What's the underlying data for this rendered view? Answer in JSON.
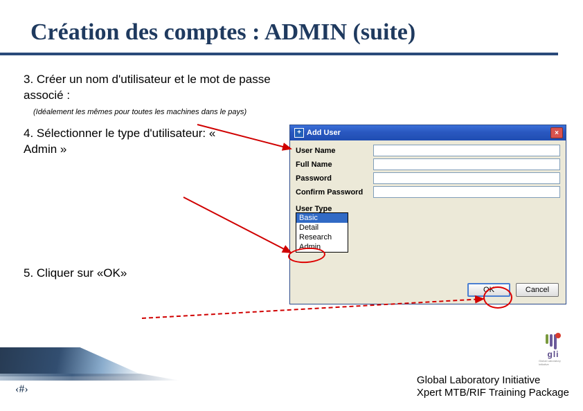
{
  "title": "Création des comptes : ADMIN (suite)",
  "steps": {
    "s3": "3. Créer un nom d'utilisateur et le mot de passe  associé :",
    "s3_note": "(Idéalement les mêmes pour toutes les machines dans le pays)",
    "s4": "4. Sélectionner le type d'utilisateur: « Admin »",
    "s5": "5. Cliquer sur «OK»"
  },
  "dialog": {
    "title": "Add User",
    "close": "×",
    "fields": {
      "user_name": "User Name",
      "full_name": "Full Name",
      "password": "Password",
      "confirm_password": "Confirm Password"
    },
    "user_type_label": "User Type",
    "user_type_selected": "Basic",
    "user_type_options": [
      "Basic",
      "Detail",
      "Research",
      "Admin"
    ],
    "ok": "OK",
    "cancel": "Cancel"
  },
  "footer": {
    "page_num": "‹#›",
    "line1": "Global Laboratory Initiative",
    "line2": "Xpert MTB/RIF Training Package",
    "logo_text": "gli",
    "logo_sub": "Global Laboratory Initiative"
  },
  "colors": {
    "title_color": "#1f3a5f",
    "arrow_red": "#d00000",
    "xp_blue": "#2a58c0"
  }
}
